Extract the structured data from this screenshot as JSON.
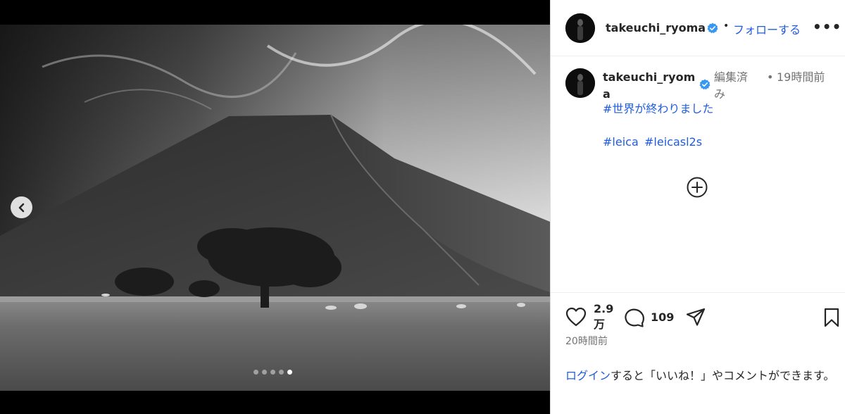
{
  "media": {
    "slide_count": 5,
    "active_slide": 5,
    "dot_color": "#ffffff"
  },
  "header": {
    "username": "takeuchi_ryoma",
    "separator": "•",
    "follow_label": "フォローする",
    "more_label": "•••",
    "accent_color": "#1f5cde",
    "verified_color": "#3897f0"
  },
  "caption": {
    "username_line1": "takeuchi_ryom",
    "username_line2": "a",
    "edited_label": "編集済み",
    "dot": "•",
    "time_label": "19時間前",
    "hashtags": [
      "#世界が終わりました",
      "#leica",
      "#leicasl2s"
    ]
  },
  "actions": {
    "like_count": "2.9万",
    "comment_count": "109",
    "post_time": "20時間前"
  },
  "login_note": {
    "link_text": "ログイン",
    "rest_text": "すると「いいね！」やコメントができます。"
  }
}
